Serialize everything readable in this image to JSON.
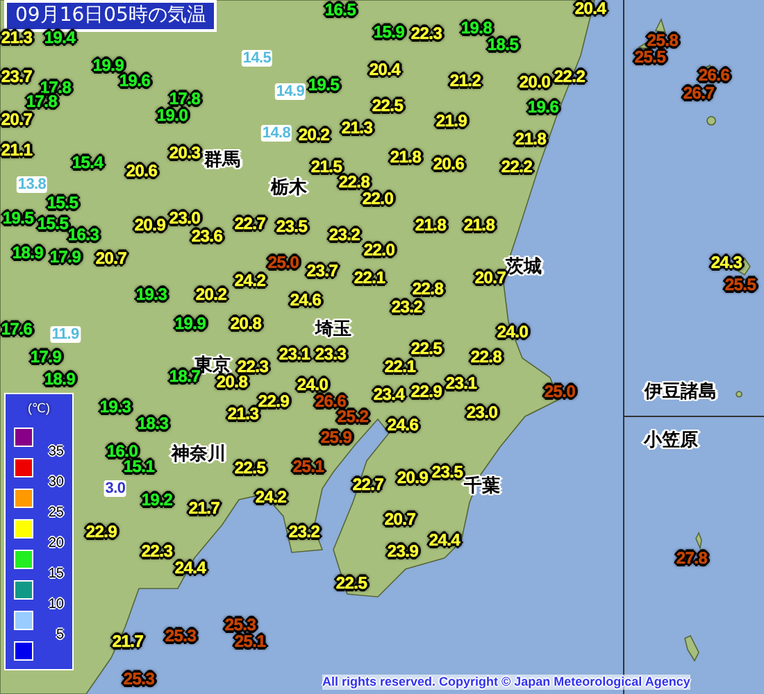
{
  "title": "09月16日05時の気温",
  "region_labels": [
    "群馬",
    "栃木",
    "茨城",
    "埼玉",
    "東京",
    "神奈川",
    "千葉",
    "伊豆諸島",
    "小笠原"
  ],
  "stations": [
    {
      "value": "16.5",
      "color": "#22ee22",
      "kind": "dark"
    },
    {
      "value": "15.9",
      "color": "#22ee22",
      "kind": "dark"
    },
    {
      "value": "22.3",
      "color": "#ffff33",
      "kind": "dark"
    },
    {
      "value": "19.8",
      "color": "#22ee22",
      "kind": "dark"
    },
    {
      "value": "18.5",
      "color": "#22ee22",
      "kind": "dark"
    },
    {
      "value": "20.4",
      "color": "#ffff33",
      "kind": "dark"
    },
    {
      "value": "20.4",
      "color": "#ffff33",
      "kind": "dark"
    },
    {
      "value": "19.5",
      "color": "#22ee22",
      "kind": "dark"
    },
    {
      "value": "14.9",
      "color": "#55bbdd",
      "kind": "light"
    },
    {
      "value": "14.5",
      "color": "#55bbdd",
      "kind": "light"
    },
    {
      "value": "21.2",
      "color": "#ffff33",
      "kind": "dark"
    },
    {
      "value": "22.5",
      "color": "#ffff33",
      "kind": "dark"
    },
    {
      "value": "21.9",
      "color": "#ffff33",
      "kind": "dark"
    },
    {
      "value": "14.8",
      "color": "#55bbdd",
      "kind": "light"
    },
    {
      "value": "20.2",
      "color": "#ffff33",
      "kind": "dark"
    },
    {
      "value": "21.3",
      "color": "#ffff33",
      "kind": "dark"
    },
    {
      "value": "21.5",
      "color": "#ffff33",
      "kind": "dark"
    },
    {
      "value": "21.8",
      "color": "#ffff33",
      "kind": "dark"
    },
    {
      "value": "20.6",
      "color": "#ffff33",
      "kind": "dark"
    },
    {
      "value": "22.8",
      "color": "#ffff33",
      "kind": "dark"
    },
    {
      "value": "22.0",
      "color": "#ffff33",
      "kind": "dark"
    },
    {
      "value": "23.5",
      "color": "#ffff33",
      "kind": "dark"
    },
    {
      "value": "23.2",
      "color": "#ffff33",
      "kind": "dark"
    },
    {
      "value": "21.8",
      "color": "#ffff33",
      "kind": "dark"
    },
    {
      "value": "21.8",
      "color": "#ffff33",
      "kind": "dark"
    },
    {
      "value": "22.0",
      "color": "#ffff33",
      "kind": "dark"
    },
    {
      "value": "25.0",
      "color": "#c84400",
      "kind": "dark"
    },
    {
      "value": "23.7",
      "color": "#ffff33",
      "kind": "dark"
    },
    {
      "value": "22.1",
      "color": "#ffff33",
      "kind": "dark"
    },
    {
      "value": "22.8",
      "color": "#ffff33",
      "kind": "dark"
    },
    {
      "value": "20.7",
      "color": "#ffff33",
      "kind": "dark"
    },
    {
      "value": "24.6",
      "color": "#ffff33",
      "kind": "dark"
    },
    {
      "value": "23.2",
      "color": "#ffff33",
      "kind": "dark"
    },
    {
      "value": "22.5",
      "color": "#ffff33",
      "kind": "dark"
    },
    {
      "value": "23.1",
      "color": "#ffff33",
      "kind": "dark"
    },
    {
      "value": "23.3",
      "color": "#ffff33",
      "kind": "dark"
    },
    {
      "value": "22.8",
      "color": "#ffff33",
      "kind": "dark"
    },
    {
      "value": "24.0",
      "color": "#ffff33",
      "kind": "dark"
    },
    {
      "value": "20.0",
      "color": "#ffff33",
      "kind": "dark"
    },
    {
      "value": "22.2",
      "color": "#ffff33",
      "kind": "dark"
    },
    {
      "value": "19.6",
      "color": "#22ee22",
      "kind": "dark"
    },
    {
      "value": "21.8",
      "color": "#ffff33",
      "kind": "dark"
    },
    {
      "value": "22.2",
      "color": "#ffff33",
      "kind": "dark"
    },
    {
      "value": "25.8",
      "color": "#c84400",
      "kind": "dark"
    },
    {
      "value": "25.5",
      "color": "#c84400",
      "kind": "dark"
    },
    {
      "value": "26.6",
      "color": "#c84400",
      "kind": "dark"
    },
    {
      "value": "26.7",
      "color": "#c84400",
      "kind": "dark"
    },
    {
      "value": "24.3",
      "color": "#ffff33",
      "kind": "dark"
    },
    {
      "value": "25.5",
      "color": "#c84400",
      "kind": "dark"
    },
    {
      "value": "21.3",
      "color": "#ffff33",
      "kind": "dark"
    },
    {
      "value": "19.4",
      "color": "#22ee22",
      "kind": "dark"
    },
    {
      "value": "23.7",
      "color": "#ffff33",
      "kind": "dark"
    },
    {
      "value": "17.8",
      "color": "#22ee22",
      "kind": "dark"
    },
    {
      "value": "17.8",
      "color": "#22ee22",
      "kind": "dark"
    },
    {
      "value": "19.9",
      "color": "#22ee22",
      "kind": "dark"
    },
    {
      "value": "19.6",
      "color": "#22ee22",
      "kind": "dark"
    },
    {
      "value": "17.8",
      "color": "#22ee22",
      "kind": "dark"
    },
    {
      "value": "20.7",
      "color": "#ffff33",
      "kind": "dark"
    },
    {
      "value": "19.0",
      "color": "#22ee22",
      "kind": "dark"
    },
    {
      "value": "21.1",
      "color": "#ffff33",
      "kind": "dark"
    },
    {
      "value": "20.3",
      "color": "#ffff33",
      "kind": "dark"
    },
    {
      "value": "15.4",
      "color": "#22ee22",
      "kind": "dark"
    },
    {
      "value": "20.6",
      "color": "#ffff33",
      "kind": "dark"
    },
    {
      "value": "13.8",
      "color": "#55bbdd",
      "kind": "light"
    },
    {
      "value": "15.5",
      "color": "#22ee22",
      "kind": "dark"
    },
    {
      "value": "19.5",
      "color": "#22ee22",
      "kind": "dark"
    },
    {
      "value": "15.5",
      "color": "#22ee22",
      "kind": "dark"
    },
    {
      "value": "16.3",
      "color": "#22ee22",
      "kind": "dark"
    },
    {
      "value": "20.9",
      "color": "#ffff33",
      "kind": "dark"
    },
    {
      "value": "23.0",
      "color": "#ffff33",
      "kind": "dark"
    },
    {
      "value": "23.6",
      "color": "#ffff33",
      "kind": "dark"
    },
    {
      "value": "22.7",
      "color": "#ffff33",
      "kind": "dark"
    },
    {
      "value": "18.9",
      "color": "#22ee22",
      "kind": "dark"
    },
    {
      "value": "17.9",
      "color": "#22ee22",
      "kind": "dark"
    },
    {
      "value": "20.7",
      "color": "#ffff33",
      "kind": "dark"
    },
    {
      "value": "19.3",
      "color": "#22ee22",
      "kind": "dark"
    },
    {
      "value": "20.2",
      "color": "#ffff33",
      "kind": "dark"
    },
    {
      "value": "24.2",
      "color": "#ffff33",
      "kind": "dark"
    },
    {
      "value": "19.9",
      "color": "#22ee22",
      "kind": "dark"
    },
    {
      "value": "20.8",
      "color": "#ffff33",
      "kind": "dark"
    },
    {
      "value": "17.6",
      "color": "#22ee22",
      "kind": "dark"
    },
    {
      "value": "11.9",
      "color": "#55bbdd",
      "kind": "light"
    },
    {
      "value": "17.9",
      "color": "#22ee22",
      "kind": "dark"
    },
    {
      "value": "18.9",
      "color": "#22ee22",
      "kind": "dark"
    },
    {
      "value": "18.7",
      "color": "#22ee22",
      "kind": "dark"
    },
    {
      "value": "20.8",
      "color": "#ffff33",
      "kind": "dark"
    },
    {
      "value": "19.3",
      "color": "#22ee22",
      "kind": "dark"
    },
    {
      "value": "18.3",
      "color": "#22ee22",
      "kind": "dark"
    },
    {
      "value": "21.3",
      "color": "#ffff33",
      "kind": "dark"
    },
    {
      "value": "16.0",
      "color": "#22ee22",
      "kind": "dark"
    },
    {
      "value": "15.1",
      "color": "#22ee22",
      "kind": "dark"
    },
    {
      "value": "22.5",
      "color": "#ffff33",
      "kind": "dark"
    },
    {
      "value": "3.0",
      "color": "#3333cc",
      "kind": "light"
    },
    {
      "value": "19.2",
      "color": "#22ee22",
      "kind": "dark"
    },
    {
      "value": "21.7",
      "color": "#ffff33",
      "kind": "dark"
    },
    {
      "value": "22.9",
      "color": "#ffff33",
      "kind": "dark"
    },
    {
      "value": "22.3",
      "color": "#ffff33",
      "kind": "dark"
    },
    {
      "value": "24.4",
      "color": "#ffff33",
      "kind": "dark"
    },
    {
      "value": "21.7",
      "color": "#ffff33",
      "kind": "dark"
    },
    {
      "value": "25.3",
      "color": "#c84400",
      "kind": "dark"
    },
    {
      "value": "25.3",
      "color": "#c84400",
      "kind": "dark"
    },
    {
      "value": "25.1",
      "color": "#c84400",
      "kind": "dark"
    },
    {
      "value": "25.3",
      "color": "#c84400",
      "kind": "dark"
    },
    {
      "value": "22.1",
      "color": "#ffff33",
      "kind": "dark"
    },
    {
      "value": "24.0",
      "color": "#ffff33",
      "kind": "dark"
    },
    {
      "value": "22.9",
      "color": "#ffff33",
      "kind": "dark"
    },
    {
      "value": "26.6",
      "color": "#c84400",
      "kind": "dark"
    },
    {
      "value": "25.2",
      "color": "#c84400",
      "kind": "dark"
    },
    {
      "value": "23.4",
      "color": "#ffff33",
      "kind": "dark"
    },
    {
      "value": "22.9",
      "color": "#ffff33",
      "kind": "dark"
    },
    {
      "value": "23.1",
      "color": "#ffff33",
      "kind": "dark"
    },
    {
      "value": "23.0",
      "color": "#ffff33",
      "kind": "dark"
    },
    {
      "value": "24.6",
      "color": "#ffff33",
      "kind": "dark"
    },
    {
      "value": "25.9",
      "color": "#c84400",
      "kind": "dark"
    },
    {
      "value": "25.1",
      "color": "#c84400",
      "kind": "dark"
    },
    {
      "value": "22.7",
      "color": "#ffff33",
      "kind": "dark"
    },
    {
      "value": "20.9",
      "color": "#ffff33",
      "kind": "dark"
    },
    {
      "value": "23.5",
      "color": "#ffff33",
      "kind": "dark"
    },
    {
      "value": "20.7",
      "color": "#ffff33",
      "kind": "dark"
    },
    {
      "value": "24.4",
      "color": "#ffff33",
      "kind": "dark"
    },
    {
      "value": "23.2",
      "color": "#ffff33",
      "kind": "dark"
    },
    {
      "value": "23.9",
      "color": "#ffff33",
      "kind": "dark"
    },
    {
      "value": "22.5",
      "color": "#ffff33",
      "kind": "dark"
    },
    {
      "value": "25.0",
      "color": "#c84400",
      "kind": "dark"
    },
    {
      "value": "27.8",
      "color": "#c84400",
      "kind": "dark"
    },
    {
      "value": "24.2",
      "color": "#ffff33",
      "kind": "dark"
    },
    {
      "value": "22.3",
      "color": "#ffff33",
      "kind": "dark"
    }
  ],
  "legend": {
    "unit": "(℃)",
    "swatches": [
      {
        "color": "#880088"
      },
      {
        "color": "#ee0000"
      },
      {
        "color": "#ff9900"
      },
      {
        "color": "#ffff00"
      },
      {
        "color": "#22ee22"
      },
      {
        "color": "#119988"
      },
      {
        "color": "#99ccff"
      },
      {
        "color": "#0000ee"
      }
    ],
    "ticks": [
      "35",
      "30",
      "25",
      "20",
      "15",
      "10",
      "5"
    ]
  },
  "copyright": "All rights reserved. Copyright © Japan Meteorological Agency"
}
